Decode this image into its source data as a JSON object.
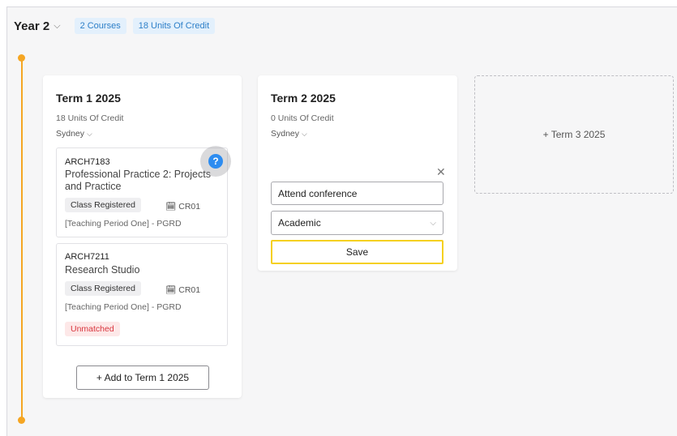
{
  "header": {
    "year_label": "Year 2",
    "chips": [
      "2 Courses",
      "18 Units Of Credit"
    ]
  },
  "terms": [
    {
      "title": "Term 1 2025",
      "units": "18 Units Of Credit",
      "location": "Sydney",
      "courses": [
        {
          "code": "ARCH7183",
          "name_line1": "Professional Practice 2: Projects",
          "name_line2": "and Practice",
          "status": "Class Registered",
          "class_code": "CR01",
          "period": "[Teaching Period One] - PGRD"
        },
        {
          "code": "ARCH7211",
          "name_line1": "Research Studio",
          "status": "Class Registered",
          "class_code": "CR01",
          "period": "[Teaching Period One] - PGRD",
          "flag": "Unmatched"
        }
      ],
      "add_button": "+ Add to Term 1 2025"
    },
    {
      "title": "Term 2 2025",
      "units": "0 Units Of Credit",
      "location": "Sydney",
      "form": {
        "input_value": "Attend conference",
        "select_value": "Academic",
        "save_label": "Save"
      }
    }
  ],
  "add_term": "+ Term 3 2025",
  "colors": {
    "timeline": "#f5a623",
    "chip_bg": "#e3f0fc",
    "chip_text": "#2d7fc8",
    "unmatched_bg": "#fde8e8",
    "unmatched_text": "#d9363e",
    "save_border": "#f5d020",
    "help": "#2d8cf0"
  }
}
